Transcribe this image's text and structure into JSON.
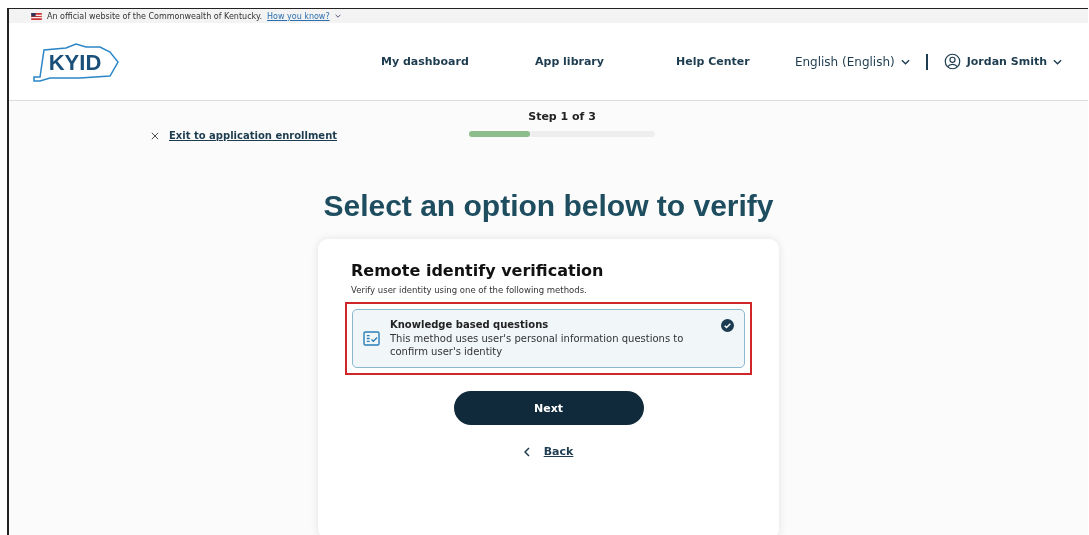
{
  "banner": {
    "text": "An official website of the Commonwealth of Kentucky.",
    "link": "How you know?"
  },
  "header": {
    "logo": "KYID",
    "nav": [
      {
        "label": "My dashboard"
      },
      {
        "label": "App library"
      },
      {
        "label": "Help Center"
      }
    ],
    "language": "English (English)",
    "user": "Jordan Smith"
  },
  "progress": {
    "step": "Step 1 of 3",
    "level": 0.33
  },
  "exit_link": "Exit to application enrollment",
  "heading": "Select an option below to verify",
  "card": {
    "title": "Remote identify verification",
    "subtitle": "Verify user identity using one of the following methods.",
    "options": [
      {
        "title": "Knowledge based questions",
        "description": "This method uses user's personal information questions to confirm user's identity",
        "selected": true,
        "highlighted": true
      }
    ],
    "next": "Next",
    "back": "Back"
  }
}
